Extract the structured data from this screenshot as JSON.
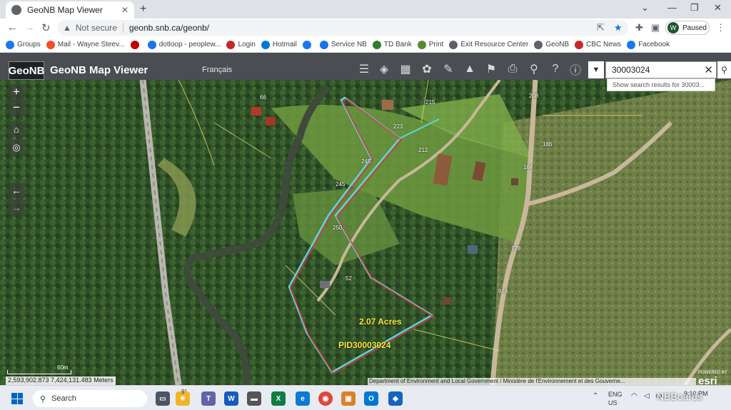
{
  "browser": {
    "tab_title": "GeoNB Map Viewer",
    "security_label": "Not secure",
    "url": "geonb.snb.ca/geonb/",
    "profile_initial": "W",
    "profile_status": "Paused"
  },
  "bookmarks": [
    {
      "label": "Groups",
      "color": "#1877f2"
    },
    {
      "label": "Mail - Wayne Steev...",
      "color": "#f25022"
    },
    {
      "label": "",
      "color": "#c00000"
    },
    {
      "label": "dotloop - peoplew...",
      "color": "#1a73e8"
    },
    {
      "label": "Login",
      "color": "#c62828"
    },
    {
      "label": "Hotmail",
      "color": "#0078d4"
    },
    {
      "label": "",
      "color": "#1877f2"
    },
    {
      "label": "Service NB",
      "color": "#1a73e8"
    },
    {
      "label": "TD Bank",
      "color": "#2e7d32"
    },
    {
      "label": "Print",
      "color": "#558b2f"
    },
    {
      "label": "Exit Resource Center",
      "color": "#5f6368"
    },
    {
      "label": "GeoNB",
      "color": "#5f6368"
    },
    {
      "label": "CBC News",
      "color": "#c62828"
    },
    {
      "label": "Facebook",
      "color": "#1877f2"
    }
  ],
  "geonb": {
    "logo_text": "GeoNB",
    "title": "GeoNB Map Viewer",
    "language_toggle": "Français",
    "search_value": "30003024",
    "search_suggestion": "Show search results for 30003..."
  },
  "map": {
    "acre_label": "2.07 Acres",
    "pid_label": "PID30003024",
    "addresses": [
      "66",
      "215",
      "208",
      "223",
      "212",
      "186",
      "245",
      "184",
      "245",
      "250",
      "178",
      "52",
      "974"
    ],
    "scale_label": "60m",
    "coordinates": "2,593,902.873 7,424,131.483 Meters",
    "attribution": "Department of Environment and Local Government / Ministère de l'Environnement et des Gouverne...",
    "esri_label": "esri",
    "esri_powered": "POWERED BY",
    "watermark": "NBBoards"
  },
  "taskbar": {
    "search_placeholder": "Search",
    "weather_temp": "9°",
    "lang_primary": "ENG",
    "lang_region": "US",
    "time": "9:10 PM"
  }
}
